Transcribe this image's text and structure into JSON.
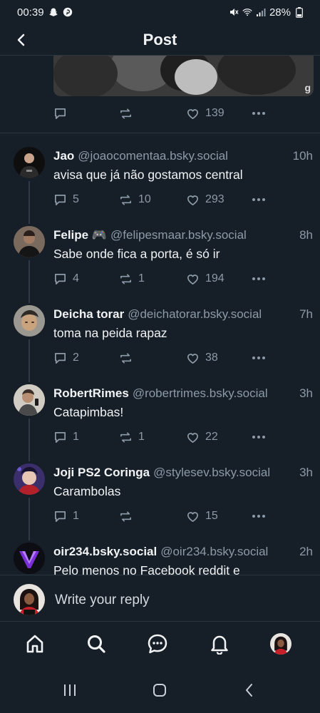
{
  "status_bar": {
    "time": "00:39",
    "battery": "28%",
    "left_icons": [
      "snapchat-icon",
      "pinterest-icon"
    ],
    "right_icons": [
      "mute-icon",
      "wifi-icon",
      "signal-icon",
      "battery-icon"
    ]
  },
  "header": {
    "title": "Post",
    "back_icon": "back-arrow-icon"
  },
  "parent_post": {
    "reply_count": "",
    "repost_count": "",
    "like_count": "139"
  },
  "replies": [
    {
      "name": "Jao",
      "handle": "@joaocomentaa.bsky.social",
      "time": "10h",
      "text": "avisa que já não gostamos central",
      "reply_count": "5",
      "repost_count": "10",
      "like_count": "293"
    },
    {
      "name": "Felipe 🎮",
      "handle": "@felipesmaar.bsky.social",
      "time": "8h",
      "text": "Sabe onde fica a porta, é só ir",
      "reply_count": "4",
      "repost_count": "1",
      "like_count": "194"
    },
    {
      "name": "Deicha torar",
      "handle": "@deichatorar.bsky.social",
      "time": "7h",
      "text": "toma na peida rapaz",
      "reply_count": "2",
      "repost_count": "",
      "like_count": "38"
    },
    {
      "name": "RobertRimes",
      "handle": "@robertrimes.bsky.social",
      "time": "3h",
      "text": "Catapimbas!",
      "reply_count": "1",
      "repost_count": "1",
      "like_count": "22"
    },
    {
      "name": "Joji PS2 Coringa",
      "handle": "@stylesev.bsky.social",
      "time": "3h",
      "text": "Carambolas",
      "reply_count": "1",
      "repost_count": "",
      "like_count": "15"
    },
    {
      "name": "oir234.bsky.social",
      "handle": "@oir234.bsky.social",
      "time": "2h",
      "text": "Pelo menos no Facebook reddit e",
      "reply_count": "",
      "repost_count": "",
      "like_count": ""
    }
  ],
  "reply_bar": {
    "placeholder": "Write your reply"
  },
  "tab_bar": {
    "tabs": [
      "home-icon",
      "search-icon",
      "chat-icon",
      "bell-icon",
      "profile-avatar"
    ]
  },
  "system_nav": {
    "buttons": [
      "recents-icon",
      "home-circle-icon",
      "back-chevron-icon"
    ]
  },
  "colors": {
    "background": "#161e27",
    "muted": "#8d9aa8",
    "divider": "#2a3542",
    "text": "#f1f3f5"
  }
}
